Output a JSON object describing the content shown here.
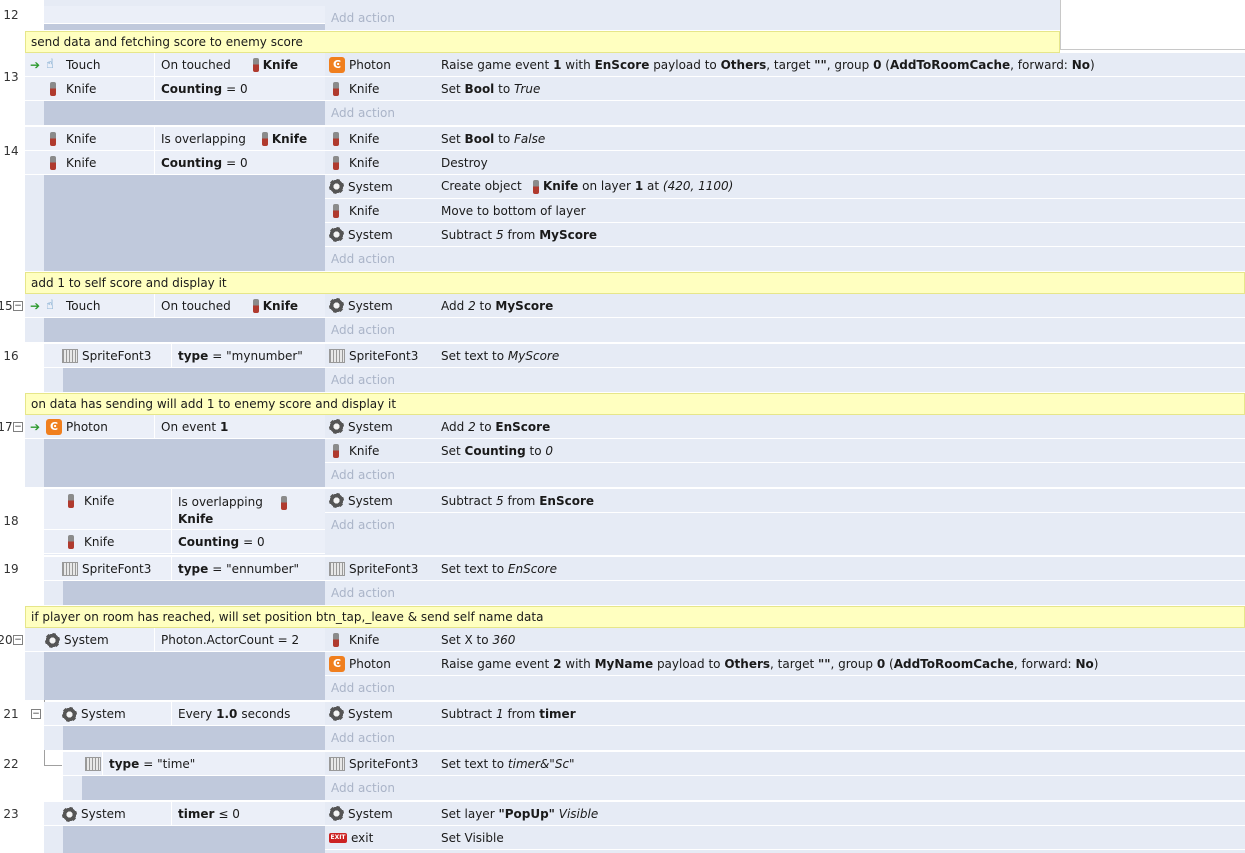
{
  "row_numbers": [
    "12",
    "13",
    "14",
    "15",
    "16",
    "17",
    "18",
    "19",
    "20",
    "21",
    "22",
    "23"
  ],
  "add_action_label": "Add action",
  "comments": {
    "c13": "send data and fetching score to enemy score",
    "c15": "add 1 to self score and display it",
    "c17": "on data has sending will add 1 to enemy score and display it",
    "c20": "if player on room has reached, will set position btn_tap,_leave & send self name data"
  },
  "objects": {
    "touch": "Touch",
    "knife": "Knife",
    "photon": "Photon",
    "system": "System",
    "spritefont3": "SpriteFont3",
    "exit": "exit"
  },
  "conditions": {
    "on_touched": "On touched",
    "counting": "Counting",
    "eq_zero": "= 0",
    "is_overlapping": "Is overlapping",
    "type_label": "type",
    "mynumber": "= \"mynumber\"",
    "ennumber": "= \"ennumber\"",
    "time": "= \"time\"",
    "on_event": "On event",
    "event_1": "1",
    "actorcount": "Photon.ActorCount = 2",
    "every": "Every",
    "every_val": "1.0",
    "seconds": "seconds",
    "timer": "timer",
    "le_zero": "≤ 0"
  },
  "actions": {
    "raise1_a": "Raise game event",
    "raise1_n": "1",
    "raise_with": "with",
    "raise1_payload": "EnScore",
    "raise_payload_to": "payload to",
    "raise_others": "Others",
    "raise_target": ", target",
    "raise_quotes": "\"\"",
    "raise_group": ", group",
    "raise_group_n": "0",
    "raise_cache": "AddToRoomCache",
    "raise_forward": ", forward:",
    "raise_no": "No",
    "set": "Set",
    "bool": "Bool",
    "to": "to",
    "true_val": "True",
    "false_val": "False",
    "destroy": "Destroy",
    "create_object": "Create object",
    "on_layer": "on layer",
    "layer_1": "1",
    "at": "at",
    "coords": "(420, 1100)",
    "move_bottom": "Move to bottom of layer",
    "subtract": "Subtract",
    "five": "5",
    "from": "from",
    "myscore": "MyScore",
    "add": "Add",
    "two": "2",
    "set_text_to": "Set text to",
    "myscore_i": "MyScore",
    "enscore": "EnScore",
    "counting": "Counting",
    "zero": "0",
    "set_x_to": "Set X to",
    "x_val": "360",
    "raise2_n": "2",
    "raise2_payload": "MyName",
    "one": "1",
    "timer": "timer",
    "timer_text": "timer&\"Sc\"",
    "set_layer": "Set layer",
    "popup": "\"PopUp\"",
    "visible": "Visible",
    "set_visible": "Set Visible"
  }
}
